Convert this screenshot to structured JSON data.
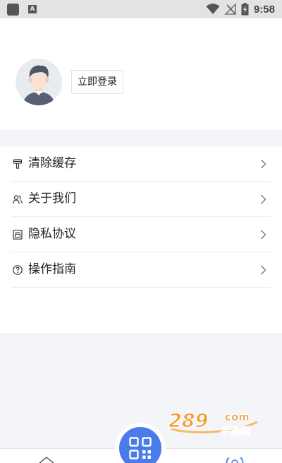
{
  "status_bar": {
    "time": "9:58",
    "notification_badge": "A",
    "icons": [
      "app-icon",
      "wifi-icon",
      "no-signal-icon",
      "battery-charging-icon"
    ]
  },
  "profile": {
    "login_label": "立即登录",
    "avatar_icon": "user-avatar"
  },
  "menu": {
    "items": [
      {
        "label": "清除缓存",
        "icon": "broom-icon"
      },
      {
        "label": "关于我们",
        "icon": "people-icon"
      },
      {
        "label": "隐私协议",
        "icon": "document-icon"
      },
      {
        "label": "操作指南",
        "icon": "help-circle-icon"
      }
    ]
  },
  "tabbar": {
    "center_icon": "qr-scan-icon",
    "icons": [
      "home-icon",
      "user-icon"
    ]
  },
  "watermark": {
    "text": "289",
    "suffix": "com",
    "subtitle": "手游网"
  },
  "colors": {
    "accent": "#4a7be8",
    "page_background": "#f4f5f9",
    "watermark_orange": "#f39a2d"
  }
}
